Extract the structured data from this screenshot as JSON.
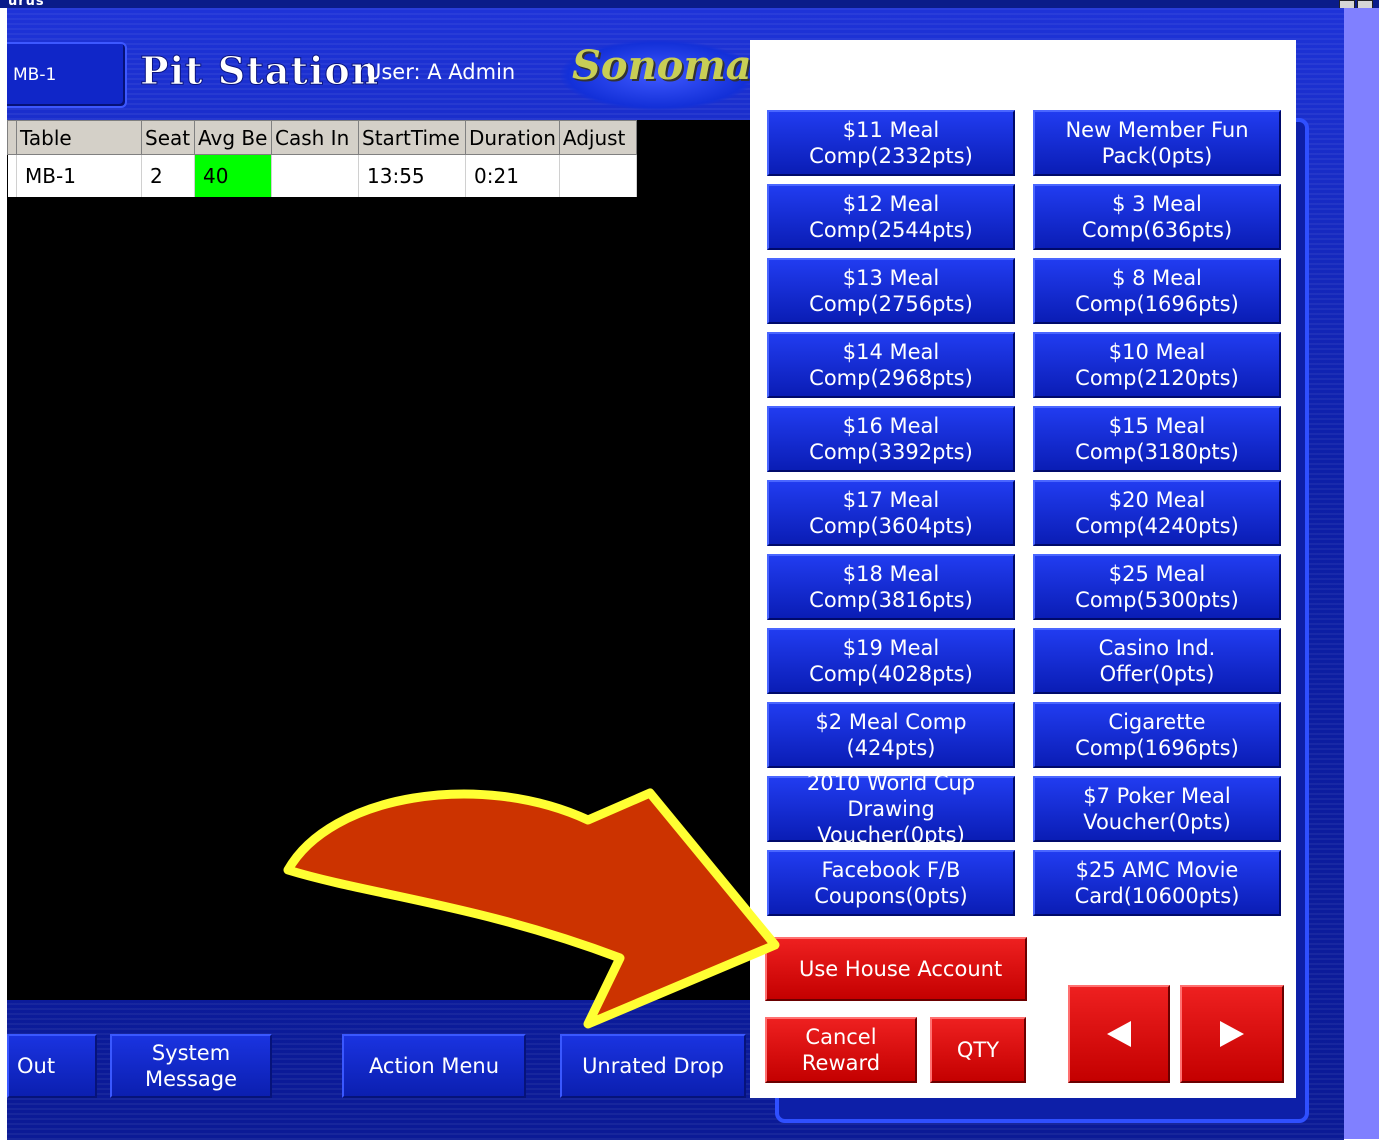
{
  "window": {
    "title": "urus"
  },
  "header": {
    "table_tab": "MB-1",
    "app_title": "Pit Station",
    "user_label": "User: A Admin",
    "brand": "Sonoma"
  },
  "grid": {
    "columns": [
      "Table",
      "Seat",
      "Avg Be",
      "Cash In",
      "StartTime",
      "Duration",
      "Adjust"
    ],
    "rows": [
      {
        "table": "MB-1",
        "seat": "2",
        "avg_bet": "40",
        "cash_in": "",
        "start_time": "13:55",
        "duration": "0:21",
        "adjust": ""
      }
    ],
    "highlight_color": "#00ff00"
  },
  "bottom_buttons": {
    "logout": "Out",
    "system_message": "System Message",
    "action_menu": "Action Menu",
    "unrated_drop": "Unrated Drop"
  },
  "rewards": {
    "left_column": [
      "$11 Meal Comp(2332pts)",
      "$12 Meal Comp(2544pts)",
      "$13 Meal Comp(2756pts)",
      "$14 Meal Comp(2968pts)",
      "$16 Meal Comp(3392pts)",
      "$17 Meal Comp(3604pts)",
      "$18 Meal Comp(3816pts)",
      "$19 Meal Comp(4028pts)",
      "$2 Meal Comp (424pts)",
      "2010 World Cup Drawing Voucher(0pts)",
      "Facebook F/B Coupons(0pts)"
    ],
    "right_column": [
      "New Member Fun Pack(0pts)",
      "$ 3 Meal Comp(636pts)",
      "$ 8 Meal Comp(1696pts)",
      "$10 Meal Comp(2120pts)",
      "$15 Meal Comp(3180pts)",
      "$20 Meal Comp(4240pts)",
      "$25 Meal Comp(5300pts)",
      "Casino Ind. Offer(0pts)",
      "Cigarette Comp(1696pts)",
      "$7 Poker Meal Voucher(0pts)",
      "$25 AMC Movie Card(10600pts)"
    ]
  },
  "actions": {
    "use_house_account": "Use House Account",
    "cancel_reward": "Cancel Reward",
    "qty": "QTY",
    "prev_icon": "left-triangle",
    "next_icon": "right-triangle"
  },
  "annotation": {
    "arrow_fill": "#cc3300",
    "arrow_outline": "#ffff33"
  }
}
